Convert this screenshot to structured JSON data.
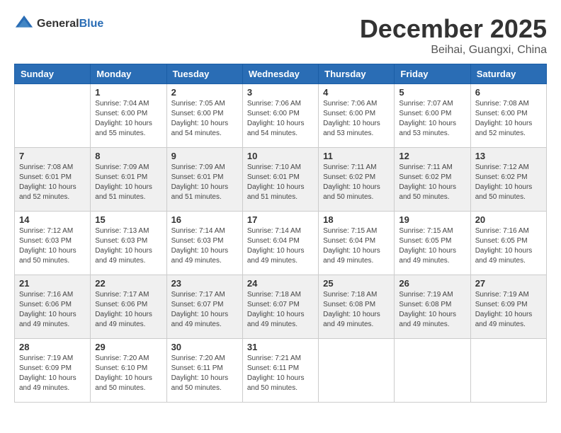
{
  "logo": {
    "general": "General",
    "blue": "Blue"
  },
  "title": "December 2025",
  "subtitle": "Beihai, Guangxi, China",
  "headers": [
    "Sunday",
    "Monday",
    "Tuesday",
    "Wednesday",
    "Thursday",
    "Friday",
    "Saturday"
  ],
  "weeks": [
    [
      {
        "day": "",
        "info": ""
      },
      {
        "day": "1",
        "info": "Sunrise: 7:04 AM\nSunset: 6:00 PM\nDaylight: 10 hours\nand 55 minutes."
      },
      {
        "day": "2",
        "info": "Sunrise: 7:05 AM\nSunset: 6:00 PM\nDaylight: 10 hours\nand 54 minutes."
      },
      {
        "day": "3",
        "info": "Sunrise: 7:06 AM\nSunset: 6:00 PM\nDaylight: 10 hours\nand 54 minutes."
      },
      {
        "day": "4",
        "info": "Sunrise: 7:06 AM\nSunset: 6:00 PM\nDaylight: 10 hours\nand 53 minutes."
      },
      {
        "day": "5",
        "info": "Sunrise: 7:07 AM\nSunset: 6:00 PM\nDaylight: 10 hours\nand 53 minutes."
      },
      {
        "day": "6",
        "info": "Sunrise: 7:08 AM\nSunset: 6:00 PM\nDaylight: 10 hours\nand 52 minutes."
      }
    ],
    [
      {
        "day": "7",
        "info": "Sunrise: 7:08 AM\nSunset: 6:01 PM\nDaylight: 10 hours\nand 52 minutes."
      },
      {
        "day": "8",
        "info": "Sunrise: 7:09 AM\nSunset: 6:01 PM\nDaylight: 10 hours\nand 51 minutes."
      },
      {
        "day": "9",
        "info": "Sunrise: 7:09 AM\nSunset: 6:01 PM\nDaylight: 10 hours\nand 51 minutes."
      },
      {
        "day": "10",
        "info": "Sunrise: 7:10 AM\nSunset: 6:01 PM\nDaylight: 10 hours\nand 51 minutes."
      },
      {
        "day": "11",
        "info": "Sunrise: 7:11 AM\nSunset: 6:02 PM\nDaylight: 10 hours\nand 50 minutes."
      },
      {
        "day": "12",
        "info": "Sunrise: 7:11 AM\nSunset: 6:02 PM\nDaylight: 10 hours\nand 50 minutes."
      },
      {
        "day": "13",
        "info": "Sunrise: 7:12 AM\nSunset: 6:02 PM\nDaylight: 10 hours\nand 50 minutes."
      }
    ],
    [
      {
        "day": "14",
        "info": "Sunrise: 7:12 AM\nSunset: 6:03 PM\nDaylight: 10 hours\nand 50 minutes."
      },
      {
        "day": "15",
        "info": "Sunrise: 7:13 AM\nSunset: 6:03 PM\nDaylight: 10 hours\nand 49 minutes."
      },
      {
        "day": "16",
        "info": "Sunrise: 7:14 AM\nSunset: 6:03 PM\nDaylight: 10 hours\nand 49 minutes."
      },
      {
        "day": "17",
        "info": "Sunrise: 7:14 AM\nSunset: 6:04 PM\nDaylight: 10 hours\nand 49 minutes."
      },
      {
        "day": "18",
        "info": "Sunrise: 7:15 AM\nSunset: 6:04 PM\nDaylight: 10 hours\nand 49 minutes."
      },
      {
        "day": "19",
        "info": "Sunrise: 7:15 AM\nSunset: 6:05 PM\nDaylight: 10 hours\nand 49 minutes."
      },
      {
        "day": "20",
        "info": "Sunrise: 7:16 AM\nSunset: 6:05 PM\nDaylight: 10 hours\nand 49 minutes."
      }
    ],
    [
      {
        "day": "21",
        "info": "Sunrise: 7:16 AM\nSunset: 6:06 PM\nDaylight: 10 hours\nand 49 minutes."
      },
      {
        "day": "22",
        "info": "Sunrise: 7:17 AM\nSunset: 6:06 PM\nDaylight: 10 hours\nand 49 minutes."
      },
      {
        "day": "23",
        "info": "Sunrise: 7:17 AM\nSunset: 6:07 PM\nDaylight: 10 hours\nand 49 minutes."
      },
      {
        "day": "24",
        "info": "Sunrise: 7:18 AM\nSunset: 6:07 PM\nDaylight: 10 hours\nand 49 minutes."
      },
      {
        "day": "25",
        "info": "Sunrise: 7:18 AM\nSunset: 6:08 PM\nDaylight: 10 hours\nand 49 minutes."
      },
      {
        "day": "26",
        "info": "Sunrise: 7:19 AM\nSunset: 6:08 PM\nDaylight: 10 hours\nand 49 minutes."
      },
      {
        "day": "27",
        "info": "Sunrise: 7:19 AM\nSunset: 6:09 PM\nDaylight: 10 hours\nand 49 minutes."
      }
    ],
    [
      {
        "day": "28",
        "info": "Sunrise: 7:19 AM\nSunset: 6:09 PM\nDaylight: 10 hours\nand 49 minutes."
      },
      {
        "day": "29",
        "info": "Sunrise: 7:20 AM\nSunset: 6:10 PM\nDaylight: 10 hours\nand 50 minutes."
      },
      {
        "day": "30",
        "info": "Sunrise: 7:20 AM\nSunset: 6:11 PM\nDaylight: 10 hours\nand 50 minutes."
      },
      {
        "day": "31",
        "info": "Sunrise: 7:21 AM\nSunset: 6:11 PM\nDaylight: 10 hours\nand 50 minutes."
      },
      {
        "day": "",
        "info": ""
      },
      {
        "day": "",
        "info": ""
      },
      {
        "day": "",
        "info": ""
      }
    ]
  ]
}
